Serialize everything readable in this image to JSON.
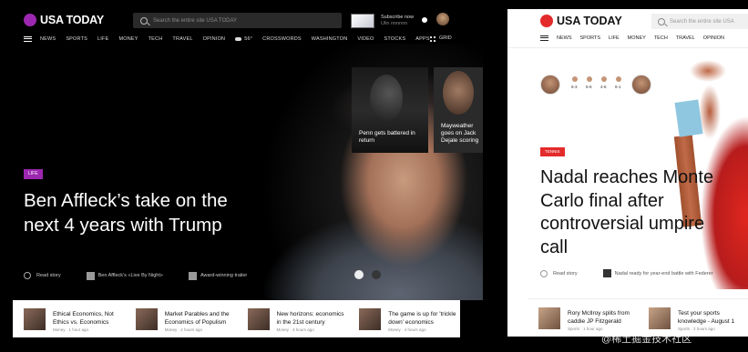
{
  "left": {
    "brand": "USA TODAY",
    "search_placeholder": "Search the entire site USA TODAY",
    "promo_text": "Subscribe now",
    "promo_sub": "Ulin nnnnnn",
    "nav": [
      "NEWS",
      "SPORTS",
      "LIFE",
      "MONEY",
      "TECH",
      "TRAVEL",
      "OPINION"
    ],
    "weather": "56°",
    "nav_right": [
      "CROSSWORDS",
      "WASHINGTON",
      "VIDEO",
      "STOCKS",
      "APPS"
    ],
    "grid_label": "GRID",
    "tile1_caption": "Penn gets battered in return",
    "tile2_caption": "Mayweather goes on Jack Dejale scoring",
    "tag": "LIFE",
    "headline": "Ben Affleck’s take on the next 4 years with Trump",
    "read_story": "Read story",
    "meta_link1": "Ben Affleck’s «Live By Night»",
    "meta_link2": "Award-winning trailer",
    "bottom": [
      {
        "title": "Ethical Economics, Not Ethics vs. Economics",
        "meta": "Money  ·  1 hour ago"
      },
      {
        "title": "Market Parables and the Economics of Populism",
        "meta": "Money  ·  2 hours ago"
      },
      {
        "title": "New horizons: economics in the 21st century",
        "meta": "Money  ·  3 hours ago"
      },
      {
        "title": "The game is up for 'trickle down' economics",
        "meta": "Money  ·  4 hours ago"
      }
    ]
  },
  "right": {
    "brand": "USA TODAY",
    "search_placeholder": "Search the entire site USA",
    "nav": [
      "NEWS",
      "SPORTS",
      "LIFE",
      "MONEY",
      "TECH",
      "TRAVEL",
      "OPINION"
    ],
    "scores": [
      "6-3",
      "5-6",
      "4-6",
      "6-1"
    ],
    "tag": "TENNIS",
    "headline": "Nadal reaches Monte Carlo final after controversial umpire call",
    "read_story": "Read story",
    "meta_link": "Nadal ready for year-end battle with Federer",
    "bottom": [
      {
        "title": "Rory McIlroy splits from caddie JP Fitzgerald",
        "meta": "Sports  ·  1 hour ago"
      },
      {
        "title": "Test your sports knowledge - August 1",
        "meta": "Sports  ·  2 hours ago"
      }
    ]
  },
  "watermark": "@稀土掘金技术社区",
  "colors": {
    "left_accent": "#9c27b0",
    "right_accent": "#e32b2b"
  }
}
